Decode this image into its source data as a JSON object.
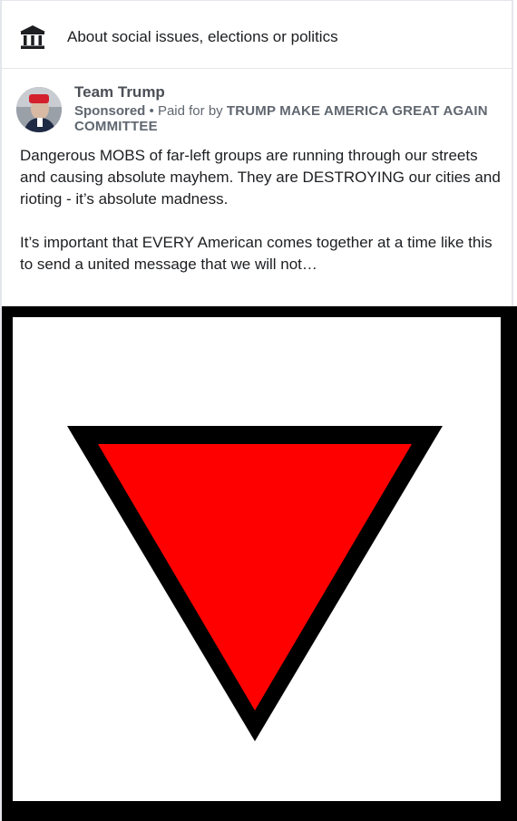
{
  "disclaimer": {
    "icon": "government-building-icon",
    "label": "About social issues, elections or politics"
  },
  "post": {
    "page_name": "Team Trump",
    "sponsored_label": "Sponsored",
    "separator": "•",
    "paid_for_by_label": "Paid for by",
    "committee": "TRUMP MAKE AMERICA GREAT AGAIN COMMITTEE",
    "paragraphs": [
      "Dangerous MOBS of far-left groups are running through our streets and causing absolute mayhem. They are DESTROYING our cities and rioting - it’s absolute madness.",
      "It’s important that EVERY American comes together at a time like this to send a united message that we will not…"
    ]
  },
  "ad_image": {
    "description_icon": "inverted-red-triangle-icon",
    "colors": {
      "frame": "#000000",
      "triangle_fill": "#ff0000",
      "triangle_outline": "#000000",
      "background": "#ffffff"
    }
  }
}
